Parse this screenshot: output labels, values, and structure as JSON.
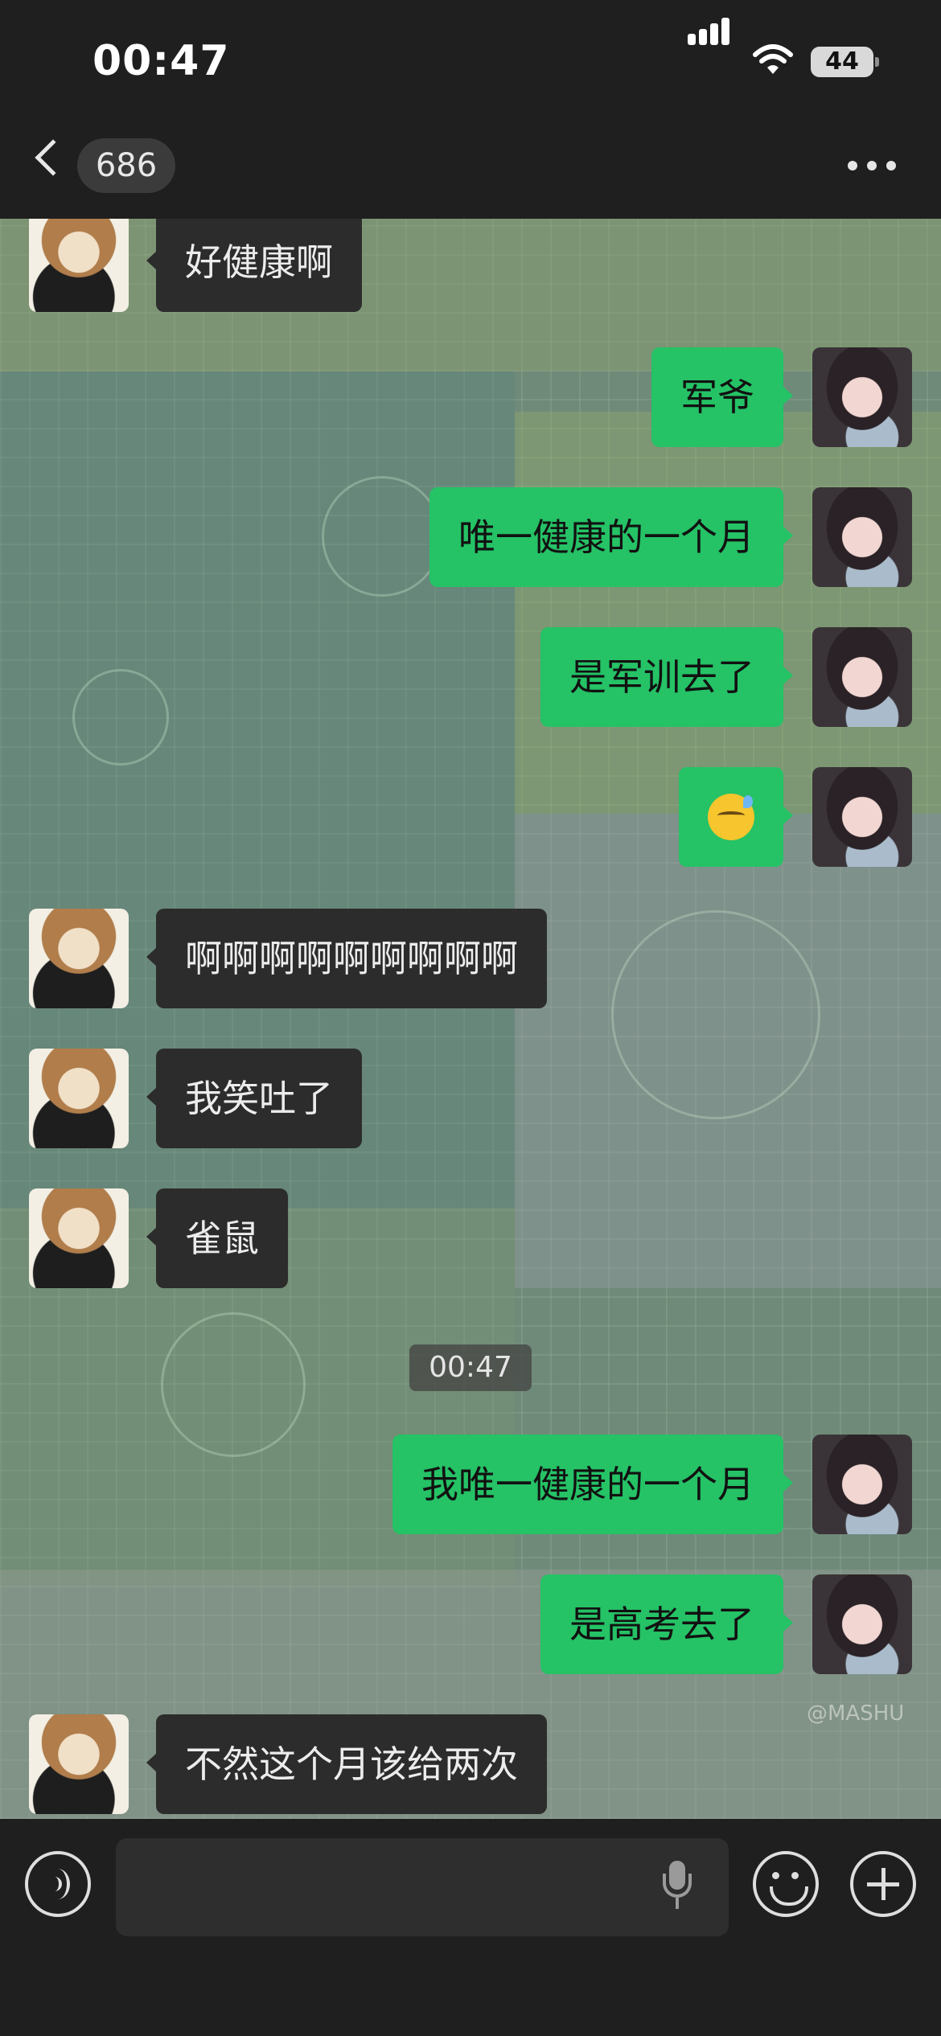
{
  "status_bar": {
    "time": "00:47",
    "battery": "44"
  },
  "header": {
    "back_badge_count": "686",
    "title": ""
  },
  "messages": [
    {
      "side": "left",
      "text": "好健康啊"
    },
    {
      "side": "right",
      "text": "军爷"
    },
    {
      "side": "right",
      "text": "唯一健康的一个月"
    },
    {
      "side": "right",
      "text": "是军训去了"
    },
    {
      "side": "right",
      "text": "",
      "emoji": "sweat-smile-emoji"
    },
    {
      "side": "left",
      "text": "啊啊啊啊啊啊啊啊啊"
    },
    {
      "side": "left",
      "text": "我笑吐了"
    },
    {
      "side": "left",
      "text": "雀鼠"
    },
    {
      "side": "right",
      "text": "我唯一健康的一个月"
    },
    {
      "side": "right",
      "text": "是高考去了"
    },
    {
      "side": "left",
      "text": "不然这个月该给两次"
    }
  ],
  "timestamp": "00:47",
  "watermark": "@MASHU",
  "input": {
    "value": "",
    "placeholder": ""
  },
  "colors": {
    "sent_bubble": "#25c266",
    "received_bubble": "#2c2c2c",
    "bar_background": "#1f1f1f"
  },
  "icons": {
    "back": "chevron-left-icon",
    "more": "more-dots-icon",
    "voice": "voice-icon",
    "mic": "microphone-icon",
    "emoji": "emoji-icon",
    "plus": "plus-icon"
  }
}
